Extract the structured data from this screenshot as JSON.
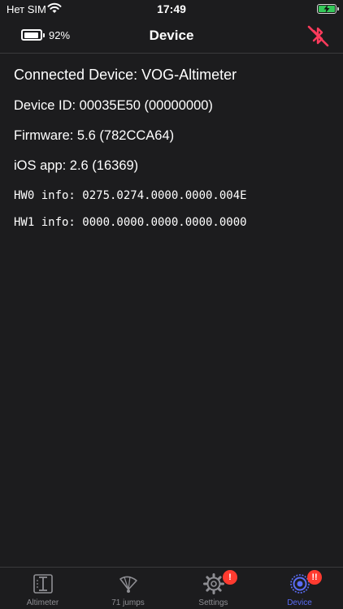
{
  "status_bar": {
    "carrier": "Нет SIM",
    "time": "17:49"
  },
  "nav": {
    "device_battery": "92%",
    "device_battery_level": 0.92,
    "title": "Device"
  },
  "device_info": {
    "connected": "Connected Device: VOG-Altimeter",
    "device_id": "Device ID: 00035E50 (00000000)",
    "firmware": "Firmware: 5.6 (782CCA64)",
    "ios_app": "iOS app: 2.6 (16369)",
    "hw0": "HW0 info: 0275.0274.0000.0000.004E",
    "hw1": "HW1 info: 0000.0000.0000.0000.0000"
  },
  "tabs": [
    {
      "label": "Altimeter",
      "icon": "altimeter-icon",
      "badge": ""
    },
    {
      "label": "71 jumps",
      "icon": "jumps-icon",
      "badge": ""
    },
    {
      "label": "Settings",
      "icon": "gear-icon",
      "badge": "!"
    },
    {
      "label": "Device",
      "icon": "device-icon",
      "badge": "!!"
    }
  ],
  "colors": {
    "background": "#1c1c1e",
    "accent": "#5a6cf5",
    "alert": "#ff3b30",
    "disconnect": "#ff3b5c",
    "inactive": "#8e8e93"
  }
}
